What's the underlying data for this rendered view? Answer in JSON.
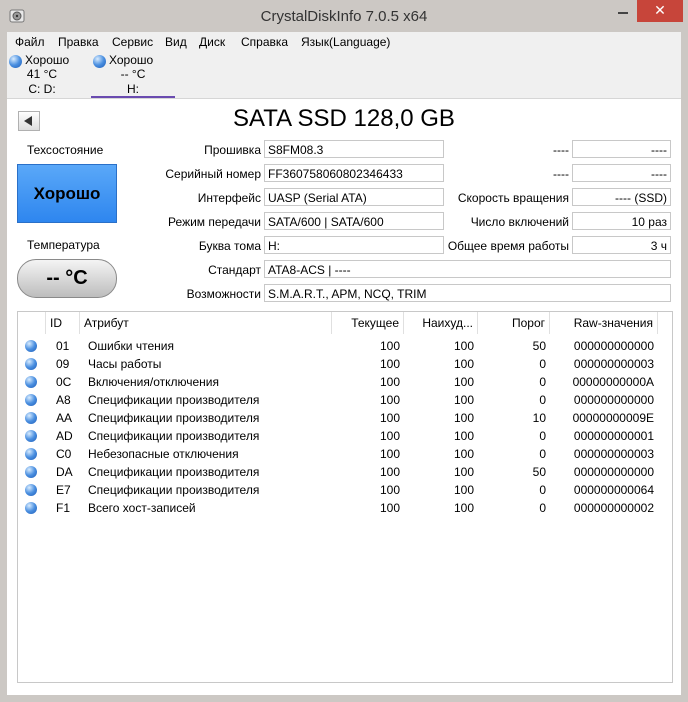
{
  "window": {
    "title": "CrystalDiskInfo 7.0.5 x64",
    "close_glyph": "✕"
  },
  "menu": [
    "Файл",
    "Правка",
    "Сервис",
    "Вид",
    "Диск",
    "Справка",
    "Язык(Language)"
  ],
  "drives": [
    {
      "status": "Хорошо",
      "temp": "41 °C",
      "letters": "C: D:"
    },
    {
      "status": "Хорошо",
      "temp": "-- °C",
      "letters": "H:"
    }
  ],
  "disk": {
    "model": "SATA SSD 128,0 GB",
    "health_label": "Техсостояние",
    "health_value": "Хорошо",
    "temp_label": "Температура",
    "temp_value": "-- °C",
    "firmware_label": "Прошивка",
    "firmware": "S8FM08.3",
    "serial_label": "Серийный номер",
    "serial": "FF360758060802346433",
    "interface_label": "Интерфейс",
    "interface": "UASP (Serial ATA)",
    "transfer_label": "Режим передачи",
    "transfer": "SATA/600 | SATA/600",
    "letter_label": "Буква тома",
    "letter": "H:",
    "standard_label": "Стандарт",
    "standard": "ATA8-ACS | ----",
    "features_label": "Возможности",
    "features": "S.M.A.R.T., APM, NCQ, TRIM",
    "r1_label": "----",
    "r1_value": "----",
    "r2_label": "----",
    "r2_value": "----",
    "rotation_label": "Скорость вращения",
    "rotation": "---- (SSD)",
    "power_count_label": "Число включений",
    "power_count": "10 раз",
    "hours_label": "Общее время работы",
    "hours": "3 ч"
  },
  "smart": {
    "headers": {
      "id": "ID",
      "attr": "Атрибут",
      "cur": "Текущее",
      "worst": "Наихуд...",
      "thr": "Порог",
      "raw": "Raw-значения"
    },
    "rows": [
      {
        "id": "01",
        "attr": "Ошибки чтения",
        "cur": "100",
        "worst": "100",
        "thr": "50",
        "raw": "000000000000"
      },
      {
        "id": "09",
        "attr": "Часы работы",
        "cur": "100",
        "worst": "100",
        "thr": "0",
        "raw": "000000000003"
      },
      {
        "id": "0C",
        "attr": "Включения/отключения",
        "cur": "100",
        "worst": "100",
        "thr": "0",
        "raw": "00000000000A"
      },
      {
        "id": "A8",
        "attr": "Спецификации производителя",
        "cur": "100",
        "worst": "100",
        "thr": "0",
        "raw": "000000000000"
      },
      {
        "id": "AA",
        "attr": "Спецификации производителя",
        "cur": "100",
        "worst": "100",
        "thr": "10",
        "raw": "00000000009E"
      },
      {
        "id": "AD",
        "attr": "Спецификации производителя",
        "cur": "100",
        "worst": "100",
        "thr": "0",
        "raw": "000000000001"
      },
      {
        "id": "C0",
        "attr": "Небезопасные отключения",
        "cur": "100",
        "worst": "100",
        "thr": "0",
        "raw": "000000000003"
      },
      {
        "id": "DA",
        "attr": "Спецификации производителя",
        "cur": "100",
        "worst": "100",
        "thr": "50",
        "raw": "000000000000"
      },
      {
        "id": "E7",
        "attr": "Спецификации производителя",
        "cur": "100",
        "worst": "100",
        "thr": "0",
        "raw": "000000000064"
      },
      {
        "id": "F1",
        "attr": "Всего хост-записей",
        "cur": "100",
        "worst": "100",
        "thr": "0",
        "raw": "000000000002"
      }
    ]
  }
}
